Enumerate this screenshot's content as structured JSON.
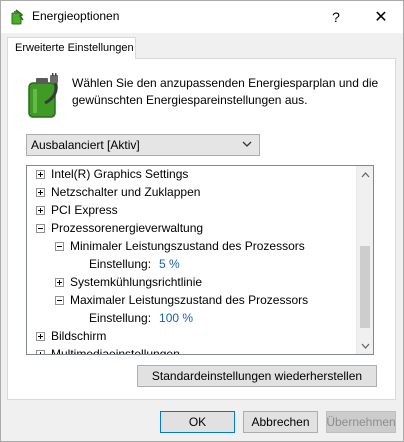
{
  "window": {
    "title": "Energieoptionen",
    "help_label": "?",
    "close_label": "✕"
  },
  "tab": {
    "label": "Erweiterte Einstellungen"
  },
  "description": "Wählen Sie den anzupassenden Energiesparplan und die gewünschten Energiespareinstellungen aus.",
  "plan_select": {
    "selected": "Ausbalanciert [Aktiv]"
  },
  "tree": {
    "items": [
      {
        "label": "Intel(R) Graphics Settings",
        "expander": "plus"
      },
      {
        "label": "Netzschalter und Zuklappen",
        "expander": "plus"
      },
      {
        "label": "PCI Express",
        "expander": "plus"
      },
      {
        "label": "Prozessorenergieverwaltung",
        "expander": "minus"
      },
      {
        "label": "Minimaler Leistungszustand des Prozessors",
        "expander": "minus"
      },
      {
        "label": "Einstellung:",
        "value": "5 %"
      },
      {
        "label": "Systemkühlungsrichtlinie",
        "expander": "plus"
      },
      {
        "label": "Maximaler Leistungszustand des Prozessors",
        "expander": "minus"
      },
      {
        "label": "Einstellung:",
        "value": "100 %"
      },
      {
        "label": "Bildschirm",
        "expander": "plus"
      },
      {
        "label": "Multimediaeinstellungen",
        "expander": "plus"
      }
    ]
  },
  "buttons": {
    "restore": "Standardeinstellungen wiederherstellen",
    "ok": "OK",
    "cancel": "Abbrechen",
    "apply": "Übernehmen"
  },
  "colors": {
    "accent": "#0078d7",
    "setting_value": "#1a5fb4"
  }
}
